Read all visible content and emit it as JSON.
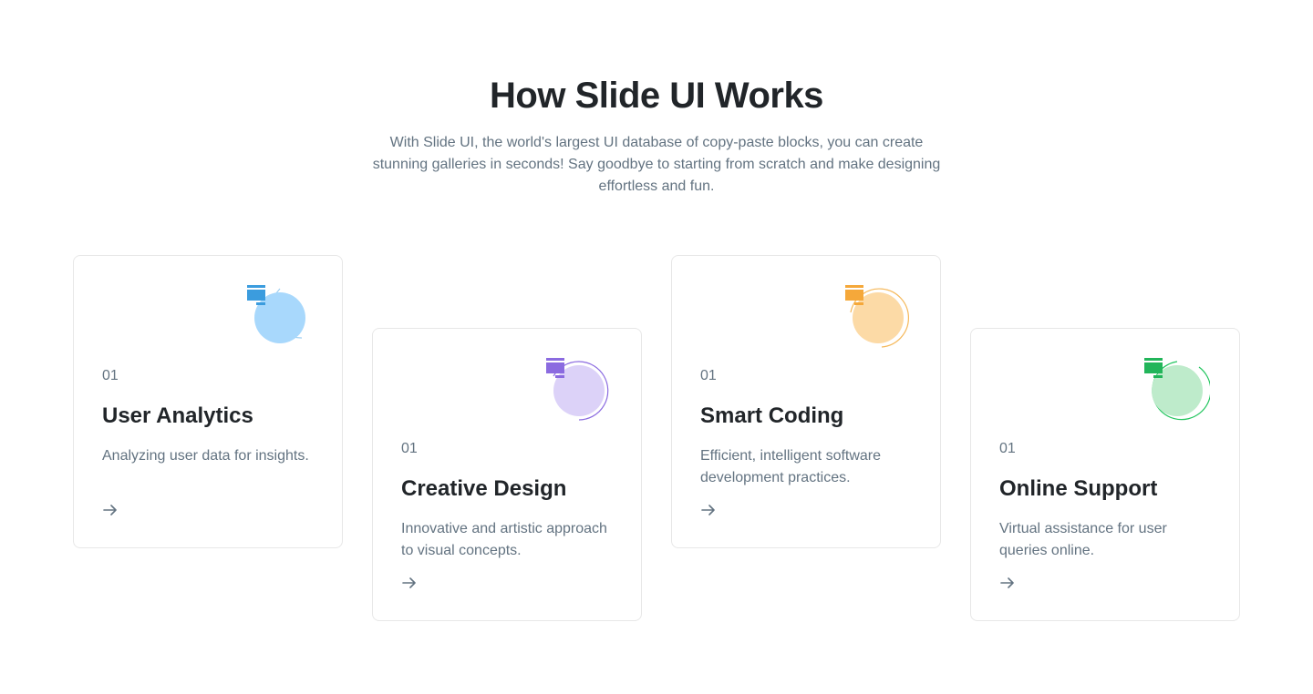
{
  "header": {
    "title": "How Slide UI Works",
    "subtitle": "With Slide UI, the world's largest UI database of copy-paste blocks, you can create stunning galleries in seconds! Say goodbye to starting from scratch and make designing effortless and fun."
  },
  "cards": [
    {
      "number": "01",
      "title": "User Analytics",
      "description": "Analyzing user data for insights.",
      "icon": "layout-icon",
      "accent": "#3B9CDE",
      "circle_fill": "#A8D8FC",
      "ring": "#9CCEF2"
    },
    {
      "number": "01",
      "title": "Creative Design",
      "description": "Innovative and artistic approach to visual concepts.",
      "icon": "layout-icon",
      "accent": "#8B6BE0",
      "circle_fill": "#DCD2F8",
      "ring": "#8B6BE0"
    },
    {
      "number": "01",
      "title": "Smart Coding",
      "description": "Efficient, intelligent software development practices.",
      "icon": "layout-icon",
      "accent": "#F5A83A",
      "circle_fill": "#FCDAA6",
      "ring": "#F5B85A"
    },
    {
      "number": "01",
      "title": "Online Support",
      "description": "Virtual assistance for user queries online.",
      "icon": "layout-icon",
      "accent": "#22B55A",
      "circle_fill": "#BEEBCB",
      "ring": "#22C55E"
    }
  ]
}
